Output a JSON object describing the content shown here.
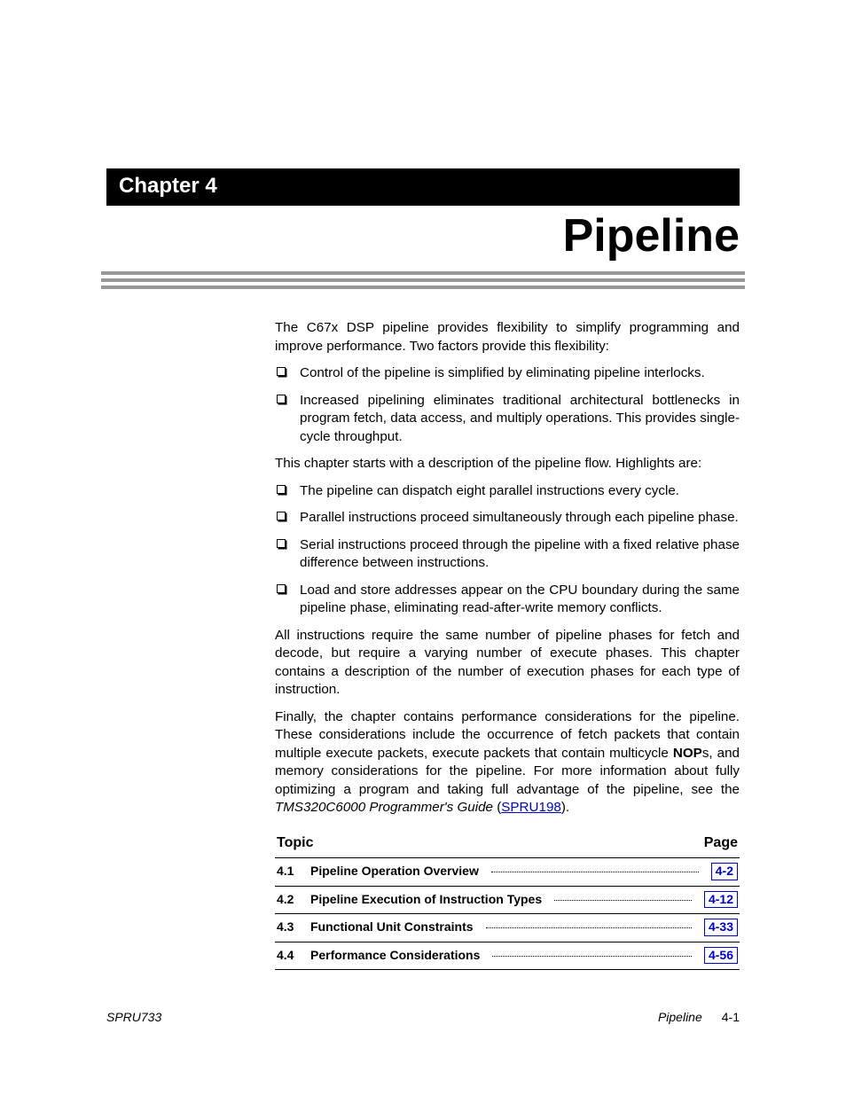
{
  "header": {
    "chapter_label": "Chapter 4",
    "title": "Pipeline"
  },
  "body": {
    "para1": "The C67x DSP pipeline provides flexibility to simplify programming and improve performance. Two factors provide this flexibility:",
    "list1": [
      "Control of the pipeline is simplified by eliminating pipeline interlocks.",
      "Increased pipelining eliminates traditional architectural bottlenecks in program fetch, data access, and multiply operations. This provides single-cycle throughput."
    ],
    "para2": "This chapter starts with a description of the pipeline flow. Highlights are:",
    "list2": [
      "The pipeline can dispatch eight parallel instructions every cycle.",
      "Parallel instructions proceed simultaneously through each pipeline phase.",
      "Serial instructions proceed through the pipeline with a fixed relative phase difference between instructions.",
      "Load and store addresses appear on the CPU boundary during the same pipeline phase, eliminating read-after-write memory conflicts."
    ],
    "para3": "All instructions require the same number of pipeline phases for fetch and decode, but require a varying number of execute phases. This chapter contains a description of the number of execution phases for each type of instruction.",
    "para4_pre": "Finally, the chapter contains performance considerations for the pipeline. These considerations include the occurrence of fetch packets that contain multiple execute packets, execute packets that contain multicycle ",
    "para4_nop": "NOP",
    "para4_mid": "s, and memory considerations for the pipeline. For more information about fully optimizing a program and taking full advantage of the pipeline, see the ",
    "para4_guide": "TMS320C6000 Programmer's Guide",
    "para4_paren_open": " (",
    "para4_link": "SPRU198",
    "para4_paren_close": ")."
  },
  "toc": {
    "head_topic": "Topic",
    "head_page": "Page",
    "rows": [
      {
        "num": "4.1",
        "title": "Pipeline Operation Overview",
        "page": "4-2"
      },
      {
        "num": "4.2",
        "title": "Pipeline Execution of Instruction Types",
        "page": "4-12"
      },
      {
        "num": "4.3",
        "title": "Functional Unit Constraints",
        "page": "4-33"
      },
      {
        "num": "4.4",
        "title": "Performance Considerations",
        "page": "4-56"
      }
    ]
  },
  "footer": {
    "left": "SPRU733",
    "right_ital": "Pipeline",
    "right_page": "4-1"
  }
}
